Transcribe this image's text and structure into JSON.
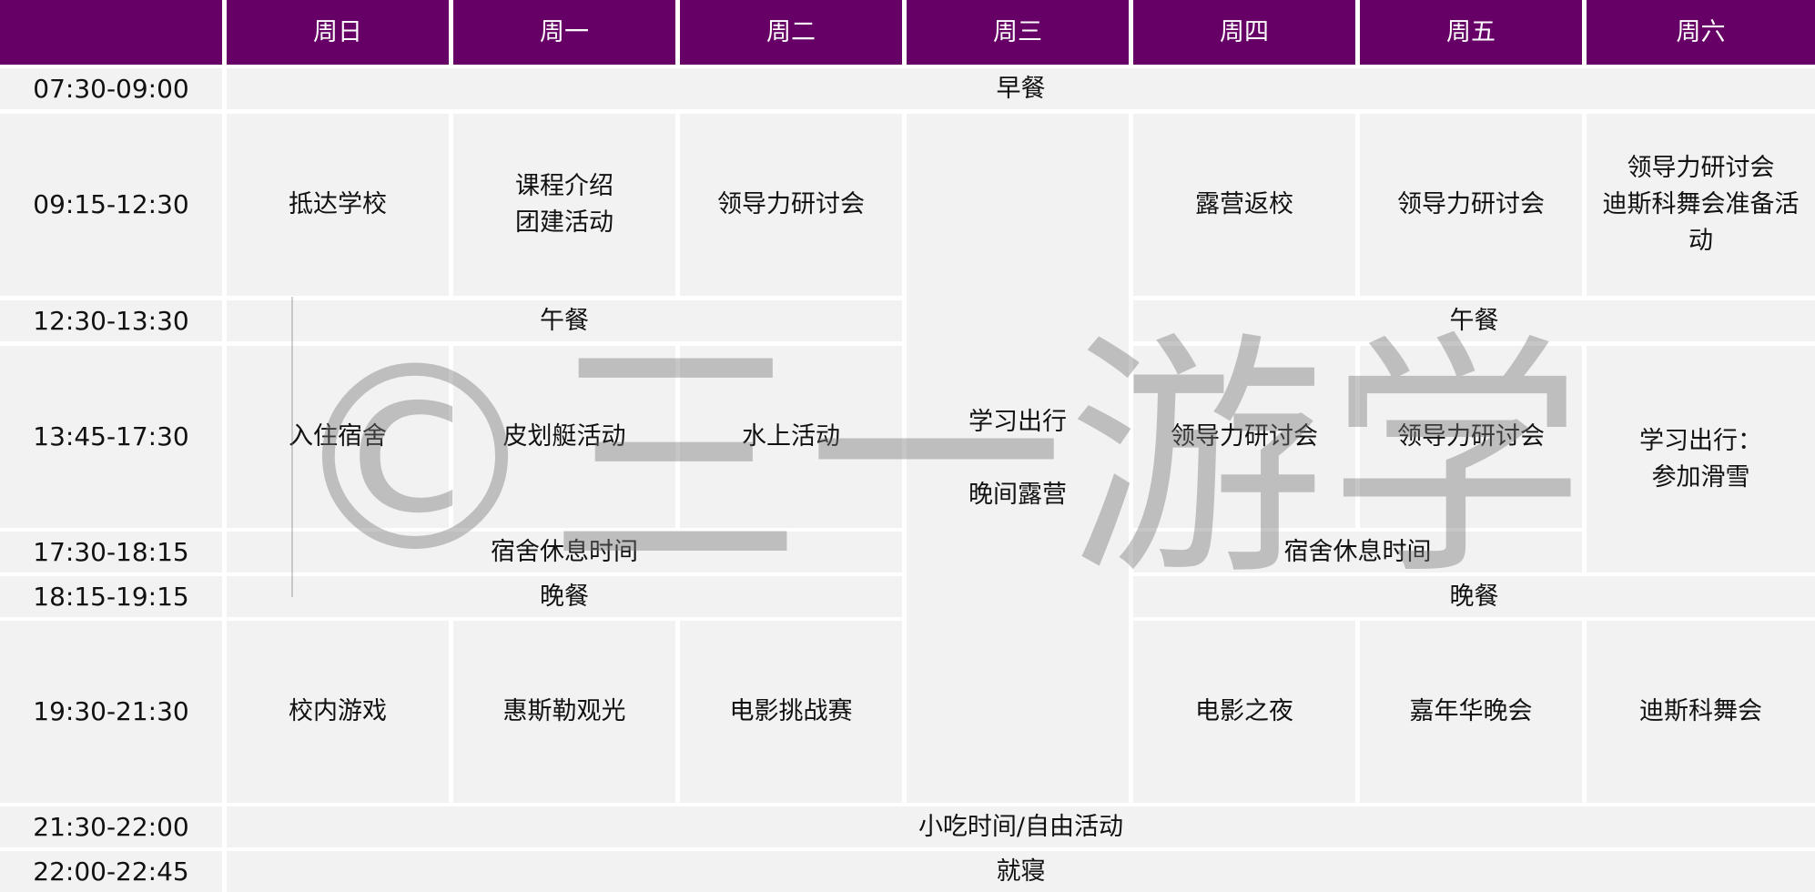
{
  "days": [
    "周日",
    "周一",
    "周二",
    "周三",
    "周四",
    "周五",
    "周六"
  ],
  "times": [
    "07:30-09:00",
    "09:15-12:30",
    "12:30-13:30",
    "13:45-17:30",
    "17:30-18:15",
    "18:15-19:15",
    "19:30-21:30",
    "21:30-22:00",
    "22:00-22:45"
  ],
  "cells": {
    "breakfast": "早餐",
    "sun_morning": "抵达学校",
    "mon_morning": [
      "课程介绍",
      "团建活动"
    ],
    "tue_morning": "领导力研讨会",
    "thu_morning": "露营返校",
    "fri_morning": "领导力研讨会",
    "sat_morning": [
      "领导力研讨会",
      "迪斯科舞会准备活",
      "动"
    ],
    "lunch_left": "午餐",
    "lunch_right": "午餐",
    "sun_afternoon": "入住宿舍",
    "mon_afternoon": "皮划艇活动",
    "tue_afternoon": "水上活动",
    "wed_trip": [
      "学习出行",
      "晚间露营"
    ],
    "thu_afternoon": "领导力研讨会",
    "fri_afternoon": "领导力研讨会",
    "sat_afternoon": [
      "学习出行：",
      "参加滑雪"
    ],
    "rest_left": "宿舍休息时间",
    "rest_right": "宿舍休息时间",
    "dinner_left": "晚餐",
    "dinner_right": "晚餐",
    "sun_evening": "校内游戏",
    "mon_evening": "惠斯勒观光",
    "tue_evening": "电影挑战赛",
    "thu_evening": "电影之夜",
    "fri_evening": "嘉年华晚会",
    "sat_evening": "迪斯科舞会",
    "snack": "小吃时间/自由活动",
    "sleep": "就寝"
  },
  "watermark": "©三一游学",
  "colors": {
    "header": "#660066",
    "cell": "#f2f2f2",
    "gridline": "#ffffff"
  }
}
